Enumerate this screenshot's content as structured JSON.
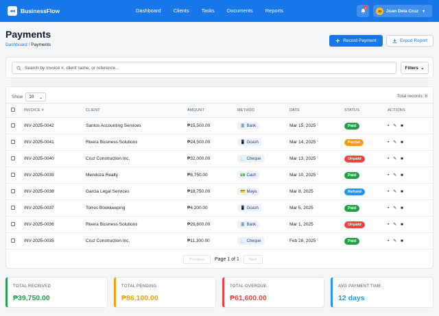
{
  "header": {
    "brand": "BusinessFlow",
    "brand_logo": "◂◂",
    "nav": [
      "Dashboard",
      "Clients",
      "Tasks",
      "Documents",
      "Reports"
    ],
    "notification_count": "3",
    "user_initials": "JD",
    "user_name": "Juan Dela Cruz"
  },
  "page": {
    "title": "Payments",
    "breadcrumb_parent": "Dashboard",
    "breadcrumb_separator": "/",
    "breadcrumb_current": "Payments",
    "record_button": "Record Payment",
    "export_button": "Export Report"
  },
  "search": {
    "placeholder": "Search by invoice #, client name, or reference...",
    "filters_label": "Filters"
  },
  "table": {
    "show_label": "Show",
    "page_size": "10",
    "total_records": "Total records: 8",
    "columns": [
      "INVOICE #",
      "CLIENT",
      "AMOUNT",
      "METHOD",
      "DATE",
      "STATUS",
      "ACTIONS"
    ],
    "rows": [
      {
        "invoice": "INV-2025-0042",
        "client": "Santos Accounting Services",
        "amount": "₱15,500.00",
        "method": "Bank",
        "method_icon": "🏦",
        "date": "Mar 15, 2025",
        "status": "Paid"
      },
      {
        "invoice": "INV-2025-0041",
        "client": "Rivera Business Solutions",
        "amount": "₱24,500.00",
        "method": "Gcash",
        "method_icon": "📱",
        "date": "Mar 14, 2025",
        "status": "Partial"
      },
      {
        "invoice": "INV-2025-0040",
        "client": "Cruz Construction Inc.",
        "amount": "₱32,000.00",
        "method": "Cheque",
        "method_icon": "🧾",
        "date": "Mar 13, 2025",
        "status": "Unpaid"
      },
      {
        "invoice": "INV-2025-0039",
        "client": "Mendoza Realty",
        "amount": "₱8,750.00",
        "method": "Cash",
        "method_icon": "💵",
        "date": "Mar 10, 2025",
        "status": "Paid"
      },
      {
        "invoice": "INV-2025-0038",
        "client": "Garcia Legal Services",
        "amount": "₱18,750.00",
        "method": "Maya",
        "method_icon": "💳",
        "date": "Mar 8, 2025",
        "status": "Refund"
      },
      {
        "invoice": "INV-2025-0037",
        "client": "Torres Bookkeeping",
        "amount": "₱4,200.00",
        "method": "Gcash",
        "method_icon": "📱",
        "date": "Mar 5, 2025",
        "status": "Paid"
      },
      {
        "invoice": "INV-2025-0036",
        "client": "Rivera Business Solutions",
        "amount": "₱29,600.00",
        "method": "Bank",
        "method_icon": "🏦",
        "date": "Mar 1, 2025",
        "status": "Unpaid"
      },
      {
        "invoice": "INV-2025-0035",
        "client": "Cruz Construction Inc.",
        "amount": "₱11,300.00",
        "method": "Cheque",
        "method_icon": "🧾",
        "date": "Feb 28, 2025",
        "status": "Paid"
      }
    ],
    "status_colors": {
      "Paid": "#22a04b",
      "Partial": "#f59e0b",
      "Unpaid": "#ef4444",
      "Refund": "#2196f3"
    },
    "pager_prev": "Previous",
    "pager_label": "Page 1 of 1",
    "pager_next": "Next"
  },
  "stats": [
    {
      "label": "TOTAL RECEIVED",
      "value": "₱39,750.00",
      "color": "#22a04b"
    },
    {
      "label": "TOTAL PENDING",
      "value": "₱86,100.00",
      "color": "#f59e0b"
    },
    {
      "label": "TOTAL OVERDUE",
      "value": "₱61,600.00",
      "color": "#ef4444"
    },
    {
      "label": "AVG PAYMENT TIME",
      "value": "12 days",
      "color": "#2196f3"
    }
  ]
}
